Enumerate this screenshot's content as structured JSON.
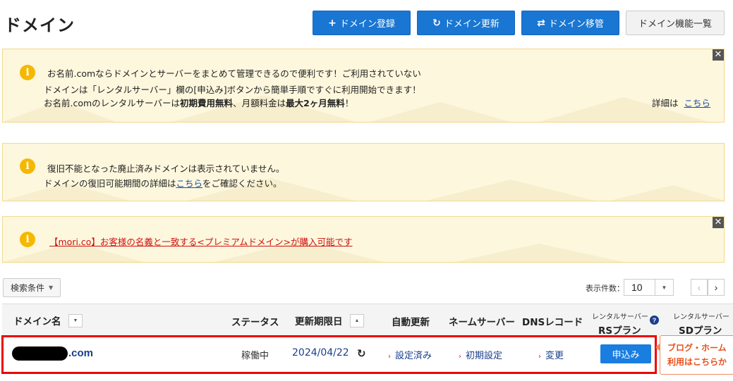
{
  "page": {
    "title": "ドメイン"
  },
  "toolbar": {
    "register_label": "ドメイン登録",
    "renew_label": "ドメイン更新",
    "transfer_label": "ドメイン移管",
    "features_label": "ドメイン機能一覧",
    "register_icon": "plus-icon",
    "renew_icon": "refresh-icon",
    "transfer_icon": "transfer-arrows-icon"
  },
  "notices": {
    "server": {
      "line1": "お名前.comならドメインとサーバーをまとめて管理できるので便利です！ご利用されていない",
      "line2": "ドメインは「レンタルサーバー」欄の[申込み]ボタンから簡単手順ですぐに利用開始できます！",
      "line3_pre": "お名前.comのレンタルサーバーは",
      "line3_bold1": "初期費用無料",
      "line3_mid": "、月額料金は",
      "line3_bold2": "最大2ヶ月無料",
      "line3_post": "！",
      "details_label": "詳細は",
      "details_link": "こちら"
    },
    "abolished": {
      "line1": "復旧不能となった廃止済みドメインは表示されていません。",
      "line2_pre": "ドメインの復旧可能期間の詳細は",
      "line2_link": "こちら",
      "line2_post": "をご確認ください。"
    },
    "premium": {
      "link": "【mori.co】お客様の名義と一致する<プレミアムドメイン>が購入可能です"
    },
    "close_label": "✕"
  },
  "filters": {
    "search_label": "検索条件",
    "per_page_label": "表示件数：",
    "per_page_value": "10",
    "prev_label": "‹",
    "next_label": "›"
  },
  "table": {
    "headers": {
      "domain": "ドメイン名",
      "status": "ステータス",
      "expiry": "更新期限日",
      "auto_renew": "自動更新",
      "nameserver": "ネームサーバー",
      "dns": "DNSレコード",
      "rs_small": "レンタルサーバー",
      "rs_plan": "RSプラン",
      "sd_small": "レンタルサーバー",
      "sd_plan": "SDプラン"
    },
    "rows": [
      {
        "domain_tld": ".com",
        "status": "稼働中",
        "expiry": "2024/04/22",
        "auto_renew": "設定済み",
        "nameserver": "初期設定",
        "dns": "変更",
        "rs_action": "申込み"
      }
    ]
  },
  "promo_tip": {
    "line1": "ブログ・ホーム",
    "line2": "利用はこちらか"
  }
}
